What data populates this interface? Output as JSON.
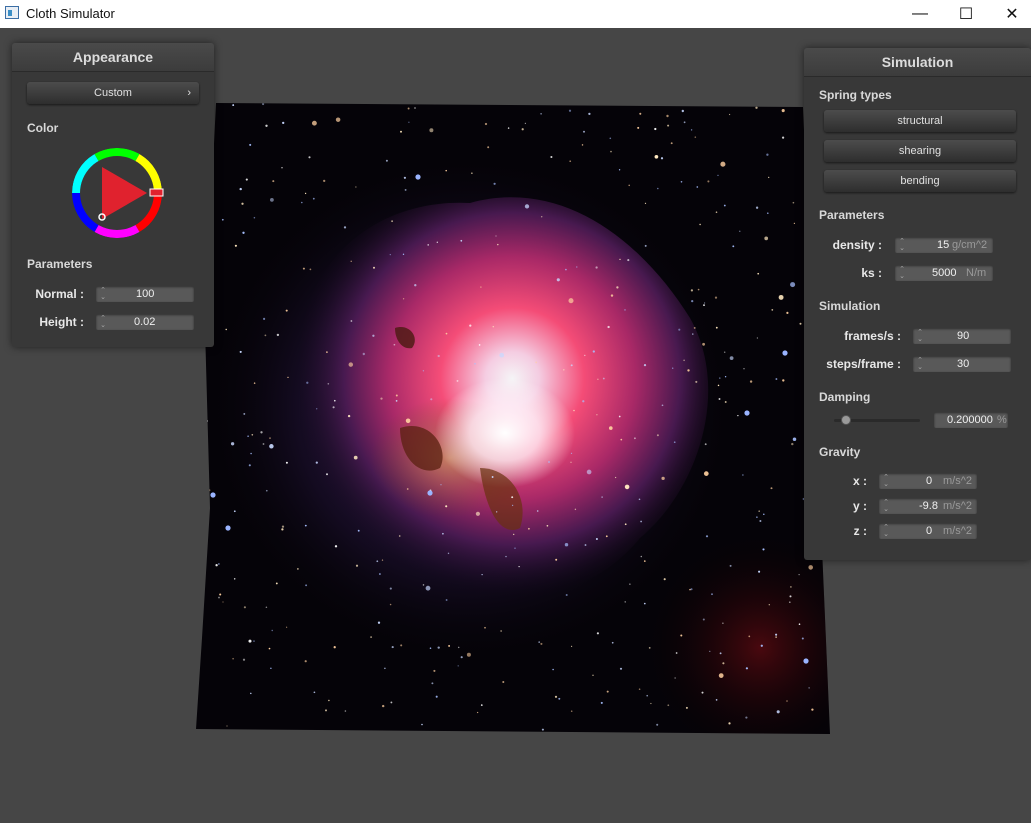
{
  "window": {
    "title": "Cloth Simulator",
    "minimize_glyph": "—",
    "maximize_glyph": "☐",
    "close_glyph": "✕"
  },
  "appearance": {
    "header": "Appearance",
    "preset": "Custom",
    "preset_chevron": "›",
    "color_label": "Color",
    "selected_color": "#e0222e",
    "parameters_label": "Parameters",
    "normal_label": "Normal :",
    "normal_value": "100",
    "height_label": "Height :",
    "height_value": "0.02"
  },
  "simulation": {
    "header": "Simulation",
    "spring_types_label": "Spring types",
    "spring_types": [
      "structural",
      "shearing",
      "bending"
    ],
    "parameters_label": "Parameters",
    "density_label": "density :",
    "density_value": "15",
    "density_unit": "g/cm^2",
    "ks_label": "ks :",
    "ks_value": "5000",
    "ks_unit": "N/m",
    "simulation_label": "Simulation",
    "fps_label": "frames/s :",
    "fps_value": "90",
    "steps_label": "steps/frame :",
    "steps_value": "30",
    "damping_label": "Damping",
    "damping_value": "0.200000",
    "damping_unit": "%",
    "damping_fraction": 0.2,
    "gravity_label": "Gravity",
    "gx_label": "x :",
    "gx_value": "0",
    "gy_label": "y :",
    "gy_value": "-9.8",
    "gz_label": "z :",
    "gz_value": "0",
    "gravity_unit": "m/s^2"
  },
  "colors": {
    "background": "#464646",
    "panel": "#383838",
    "nebula_core": "#ff4f7a"
  }
}
